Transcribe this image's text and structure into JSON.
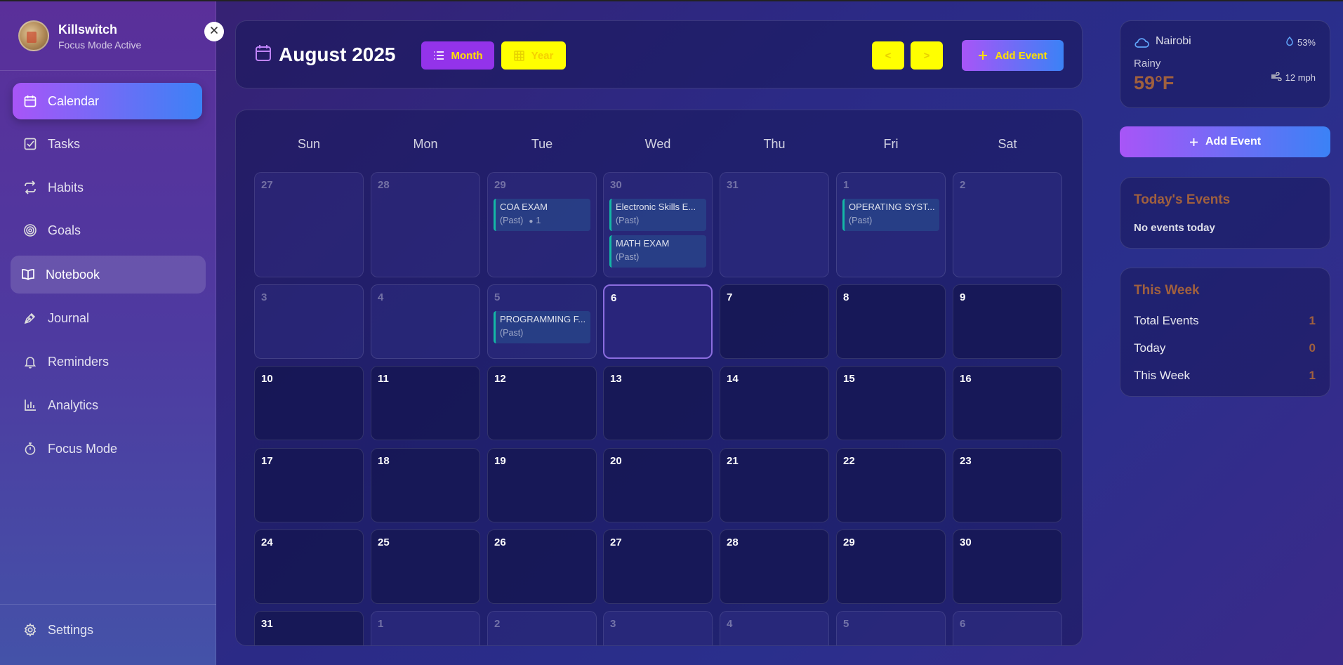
{
  "user": {
    "name": "Killswitch",
    "status": "Focus Mode Active"
  },
  "sidebar": {
    "items": [
      {
        "label": "Calendar",
        "icon": "calendar-icon"
      },
      {
        "label": "Tasks",
        "icon": "checkbox-icon"
      },
      {
        "label": "Habits",
        "icon": "repeat-icon"
      },
      {
        "label": "Goals",
        "icon": "target-icon"
      },
      {
        "label": "Notebook",
        "icon": "book-icon"
      },
      {
        "label": "Journal",
        "icon": "pen-icon"
      },
      {
        "label": "Reminders",
        "icon": "bell-icon"
      },
      {
        "label": "Analytics",
        "icon": "bar-chart-icon"
      },
      {
        "label": "Focus Mode",
        "icon": "timer-icon"
      }
    ],
    "settings_label": "Settings"
  },
  "header": {
    "title": "August 2025",
    "month_label": "Month",
    "year_label": "Year",
    "prev_label": "<",
    "next_label": ">",
    "add_event_label": "Add Event"
  },
  "calendar": {
    "weekdays": [
      "Sun",
      "Mon",
      "Tue",
      "Wed",
      "Thu",
      "Fri",
      "Sat"
    ],
    "days": [
      {
        "num": "27",
        "state": "outside"
      },
      {
        "num": "28",
        "state": "outside"
      },
      {
        "num": "29",
        "state": "outside",
        "events": [
          {
            "title": "COA EXAM",
            "status": "(Past)",
            "comments": "1"
          }
        ]
      },
      {
        "num": "30",
        "state": "outside",
        "events": [
          {
            "title": "Electronic Skills E...",
            "status": "(Past)"
          },
          {
            "title": "MATH EXAM",
            "status": "(Past)"
          }
        ]
      },
      {
        "num": "31",
        "state": "outside"
      },
      {
        "num": "1",
        "state": "past",
        "events": [
          {
            "title": "OPERATING SYST...",
            "status": "(Past)"
          }
        ]
      },
      {
        "num": "2",
        "state": "past"
      },
      {
        "num": "3",
        "state": "past"
      },
      {
        "num": "4",
        "state": "past"
      },
      {
        "num": "5",
        "state": "past",
        "events": [
          {
            "title": "PROGRAMMING F...",
            "status": "(Past)"
          }
        ]
      },
      {
        "num": "6",
        "state": "today"
      },
      {
        "num": "7",
        "state": "current"
      },
      {
        "num": "8",
        "state": "current"
      },
      {
        "num": "9",
        "state": "current"
      },
      {
        "num": "10",
        "state": "current"
      },
      {
        "num": "11",
        "state": "current"
      },
      {
        "num": "12",
        "state": "current"
      },
      {
        "num": "13",
        "state": "current"
      },
      {
        "num": "14",
        "state": "current"
      },
      {
        "num": "15",
        "state": "current"
      },
      {
        "num": "16",
        "state": "current"
      },
      {
        "num": "17",
        "state": "current"
      },
      {
        "num": "18",
        "state": "current"
      },
      {
        "num": "19",
        "state": "current"
      },
      {
        "num": "20",
        "state": "current"
      },
      {
        "num": "21",
        "state": "current"
      },
      {
        "num": "22",
        "state": "current"
      },
      {
        "num": "23",
        "state": "current"
      },
      {
        "num": "24",
        "state": "current"
      },
      {
        "num": "25",
        "state": "current"
      },
      {
        "num": "26",
        "state": "current"
      },
      {
        "num": "27",
        "state": "current"
      },
      {
        "num": "28",
        "state": "current"
      },
      {
        "num": "29",
        "state": "current"
      },
      {
        "num": "30",
        "state": "current"
      },
      {
        "num": "31",
        "state": "current"
      },
      {
        "num": "1",
        "state": "outside"
      },
      {
        "num": "2",
        "state": "outside"
      },
      {
        "num": "3",
        "state": "outside"
      },
      {
        "num": "4",
        "state": "outside"
      },
      {
        "num": "5",
        "state": "outside"
      },
      {
        "num": "6",
        "state": "outside"
      }
    ]
  },
  "weather": {
    "city": "Nairobi",
    "humidity": "53%",
    "condition": "Rainy",
    "temperature": "59°F",
    "wind": "12 mph"
  },
  "side": {
    "add_event_label": "Add Event"
  },
  "today_events": {
    "title": "Today's Events",
    "empty": "No events today"
  },
  "this_week": {
    "title": "This Week",
    "stats": [
      {
        "label": "Total Events",
        "value": "1"
      },
      {
        "label": "Today",
        "value": "0"
      },
      {
        "label": "This Week",
        "value": "1"
      }
    ]
  },
  "colors": {
    "accent_start": "#a855f7",
    "accent_end": "#3b82f6",
    "highlight": "#ffff00",
    "event_border": "#14b8a6",
    "stat": "#a0603e"
  }
}
